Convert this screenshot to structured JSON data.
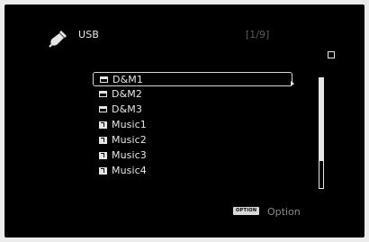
{
  "header": {
    "source_icon": "usb-plug-icon",
    "title": "USB",
    "page_indicator": "[1/9]"
  },
  "status": {
    "stop_icon": "stop-icon"
  },
  "list": {
    "items": [
      {
        "type": "folder",
        "icon": "folder-icon",
        "label": "D&M1",
        "selected": true
      },
      {
        "type": "folder",
        "icon": "folder-icon",
        "label": "D&M2",
        "selected": false
      },
      {
        "type": "folder",
        "icon": "folder-icon",
        "label": "D&M3",
        "selected": false
      },
      {
        "type": "music",
        "icon": "music-file-icon",
        "label": "Music1",
        "selected": false
      },
      {
        "type": "music",
        "icon": "music-file-icon",
        "label": "Music2",
        "selected": false
      },
      {
        "type": "music",
        "icon": "music-file-icon",
        "label": "Music3",
        "selected": false
      },
      {
        "type": "music",
        "icon": "music-file-icon",
        "label": "Music4",
        "selected": false
      }
    ],
    "scroll_position_fraction": 0.0,
    "visible_fraction": 0.75
  },
  "footer": {
    "option_badge": "OPTION",
    "option_label": "Option"
  },
  "colors": {
    "background": "#000000",
    "text": "#e6e6e6",
    "dim_text": "#5c5c5c",
    "frame": "#ececec"
  }
}
